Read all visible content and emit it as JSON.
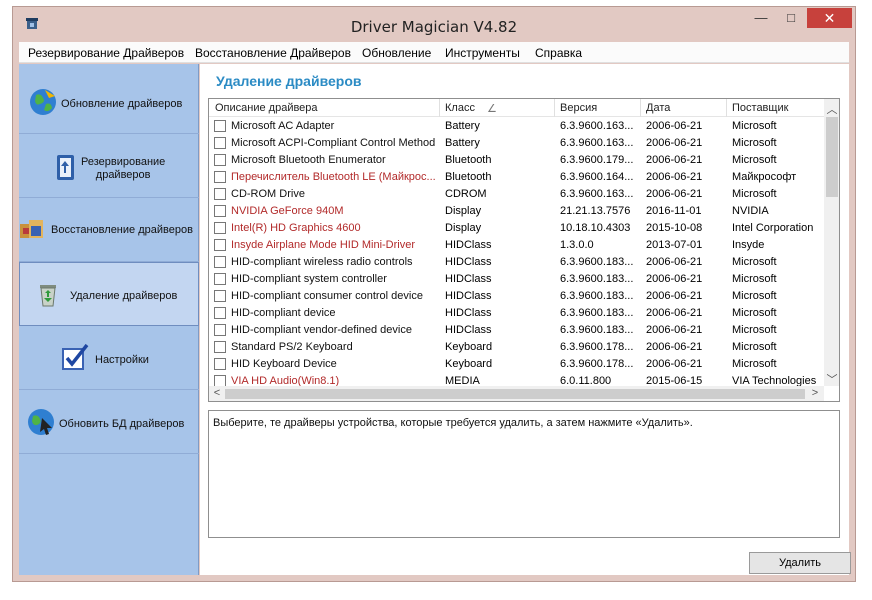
{
  "window": {
    "title": "Driver Magician V4.82",
    "minimize_glyph": "—",
    "maximize_glyph": "□",
    "close_glyph": "✕"
  },
  "menu": [
    "Резервирование Драйверов",
    "Восстановление Драйверов",
    "Обновление",
    "Инструменты",
    "Справка"
  ],
  "sidebar": [
    {
      "label": "Обновление драйверов",
      "icon": "globe-update-icon"
    },
    {
      "label": "Резервирование\nдрайверов",
      "icon": "backup-book-icon"
    },
    {
      "label": "Восстановление драйверов",
      "icon": "restore-boxes-icon"
    },
    {
      "label": "Удаление драйверов",
      "icon": "recycle-bin-icon",
      "active": true
    },
    {
      "label": "Настройки",
      "icon": "settings-checkbox-icon"
    },
    {
      "label": "Обновить БД драйверов",
      "icon": "globe-arrow-icon"
    }
  ],
  "main": {
    "heading": "Удаление драйверов",
    "columns": [
      "Описание драйвера",
      "Класс",
      "Версия",
      "Дата",
      "Поставщик"
    ],
    "sort_indicator": "∠",
    "rows": [
      {
        "desc": "Microsoft AC Adapter",
        "cls": "Battery",
        "ver": "6.3.9600.163...",
        "date": "2006-06-21",
        "vendor": "Microsoft",
        "red": false
      },
      {
        "desc": "Microsoft ACPI-Compliant Control Method ...",
        "cls": "Battery",
        "ver": "6.3.9600.163...",
        "date": "2006-06-21",
        "vendor": "Microsoft",
        "red": false
      },
      {
        "desc": "Microsoft Bluetooth Enumerator",
        "cls": "Bluetooth",
        "ver": "6.3.9600.179...",
        "date": "2006-06-21",
        "vendor": "Microsoft",
        "red": false
      },
      {
        "desc": "Перечислитель Bluetooth LE (Майкрос...",
        "cls": "Bluetooth",
        "ver": "6.3.9600.164...",
        "date": "2006-06-21",
        "vendor": "Майкрософт",
        "red": true
      },
      {
        "desc": "CD-ROM Drive",
        "cls": "CDROM",
        "ver": "6.3.9600.163...",
        "date": "2006-06-21",
        "vendor": "Microsoft",
        "red": false
      },
      {
        "desc": "NVIDIA GeForce 940M",
        "cls": "Display",
        "ver": "21.21.13.7576",
        "date": "2016-11-01",
        "vendor": "NVIDIA",
        "red": true
      },
      {
        "desc": "Intel(R) HD Graphics 4600",
        "cls": "Display",
        "ver": "10.18.10.4303",
        "date": "2015-10-08",
        "vendor": "Intel Corporation",
        "red": true
      },
      {
        "desc": "Insyde Airplane Mode HID Mini-Driver",
        "cls": "HIDClass",
        "ver": "1.3.0.0",
        "date": "2013-07-01",
        "vendor": "Insyde",
        "red": true
      },
      {
        "desc": "HID-compliant wireless radio controls",
        "cls": "HIDClass",
        "ver": "6.3.9600.183...",
        "date": "2006-06-21",
        "vendor": "Microsoft",
        "red": false
      },
      {
        "desc": "HID-compliant system controller",
        "cls": "HIDClass",
        "ver": "6.3.9600.183...",
        "date": "2006-06-21",
        "vendor": "Microsoft",
        "red": false
      },
      {
        "desc": "HID-compliant consumer control device",
        "cls": "HIDClass",
        "ver": "6.3.9600.183...",
        "date": "2006-06-21",
        "vendor": "Microsoft",
        "red": false
      },
      {
        "desc": "HID-compliant device",
        "cls": "HIDClass",
        "ver": "6.3.9600.183...",
        "date": "2006-06-21",
        "vendor": "Microsoft",
        "red": false
      },
      {
        "desc": "HID-compliant vendor-defined device",
        "cls": "HIDClass",
        "ver": "6.3.9600.183...",
        "date": "2006-06-21",
        "vendor": "Microsoft",
        "red": false
      },
      {
        "desc": "Standard PS/2 Keyboard",
        "cls": "Keyboard",
        "ver": "6.3.9600.178...",
        "date": "2006-06-21",
        "vendor": "Microsoft",
        "red": false
      },
      {
        "desc": "HID Keyboard Device",
        "cls": "Keyboard",
        "ver": "6.3.9600.178...",
        "date": "2006-06-21",
        "vendor": "Microsoft",
        "red": false
      },
      {
        "desc": "VIA HD Audio(Win8.1)",
        "cls": "MEDIA",
        "ver": "6.0.11.800",
        "date": "2015-06-15",
        "vendor": "VIA Technologies",
        "red": true
      }
    ],
    "description": "Выберите, те драйверы устройства, которые требуется удалить, а затем нажмите «Удалить».",
    "delete_button": "Удалить"
  },
  "colors": {
    "accent_heading": "#2b8bc4",
    "red_text": "#b22a2a",
    "sidebar_bg": "#a7c4e9",
    "close_red": "#c7413c"
  }
}
